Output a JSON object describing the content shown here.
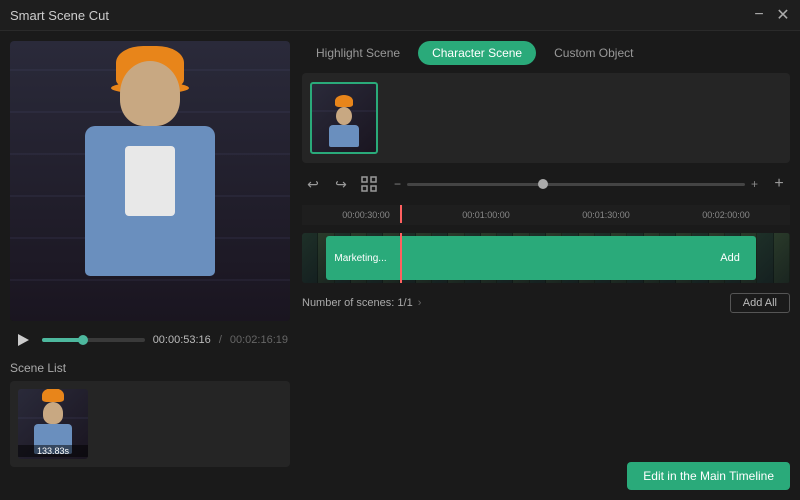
{
  "titleBar": {
    "title": "Smart Scene Cut",
    "minimizeIcon": "−",
    "closeIcon": "✕"
  },
  "tabs": [
    {
      "id": "highlight",
      "label": "Highlight Scene",
      "active": false
    },
    {
      "id": "character",
      "label": "Character Scene",
      "active": true
    },
    {
      "id": "custom",
      "label": "Custom Object",
      "active": false
    }
  ],
  "playback": {
    "currentTime": "00:00:53:16",
    "totalTime": "00:02:16:19",
    "divider": "/"
  },
  "timeline": {
    "markers": [
      {
        "label": "00:00:30:00"
      },
      {
        "label": "00:01:00:00"
      },
      {
        "label": "00:01:30:00"
      },
      {
        "label": "00:02:00:00"
      }
    ],
    "segment": {
      "label": "Marketing...",
      "addBtnLabel": "Add"
    }
  },
  "scenesInfo": {
    "label": "Number of scenes:",
    "count": "1/1"
  },
  "addAllBtn": "Add All",
  "sceneList": {
    "label": "Scene List",
    "items": [
      {
        "duration": "133.83s"
      }
    ]
  },
  "editBtn": "Edit in the Main Timeline",
  "controls": {
    "undo": "↩",
    "redo": "↪",
    "fullscreen": "⛶",
    "zoomOut": "−",
    "zoomIn": "+"
  }
}
